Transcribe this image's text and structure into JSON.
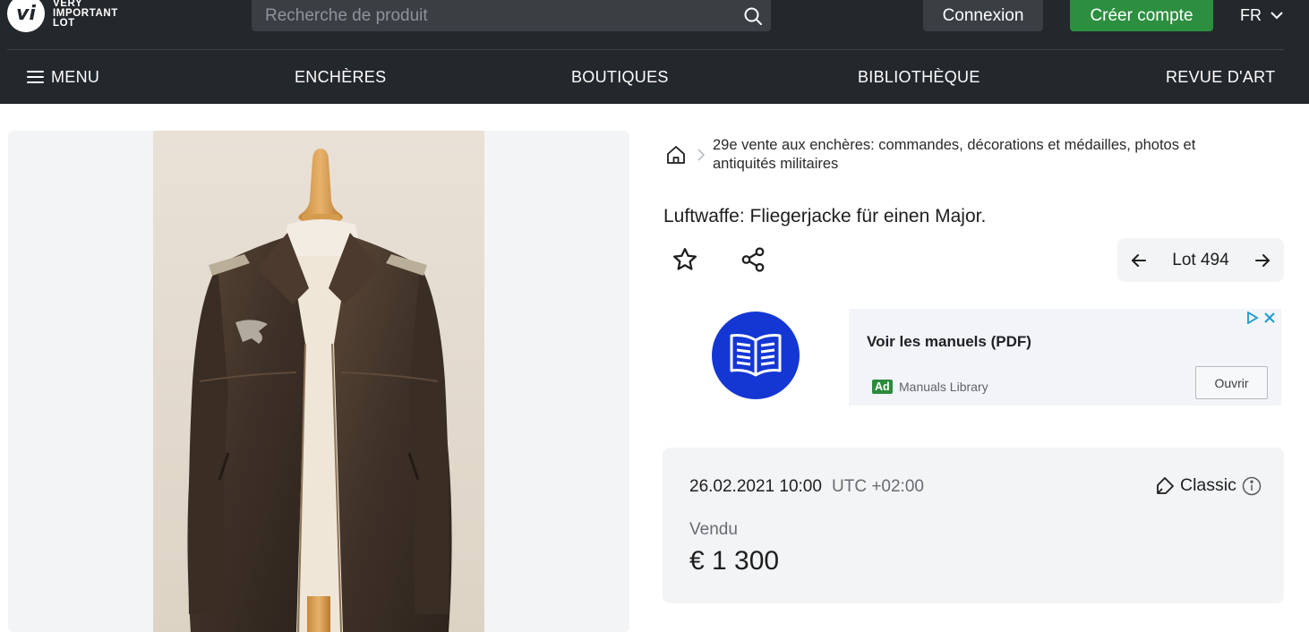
{
  "header": {
    "logo": {
      "mark": "vi",
      "lines": [
        "VERY",
        "IMPORTANT",
        "LOT"
      ]
    },
    "search": {
      "placeholder": "Recherche de produit",
      "icon": "search-icon"
    },
    "login_label": "Connexion",
    "signup_label": "Créer compte",
    "language": "FR",
    "colors": {
      "bar": "#23282c",
      "signup": "#2c8f3f"
    }
  },
  "nav": {
    "menu_label": "MENU",
    "items": [
      "ENCHÈRES",
      "BOUTIQUES",
      "BIBLIOTHÈQUE",
      "REVUE D'ART"
    ]
  },
  "breadcrumb": {
    "home_icon": "home-icon",
    "text": "29e vente aux enchères: commandes, décorations et médailles, photos et antiquités militaires"
  },
  "lot": {
    "title": "Luftwaffe: Fliegerjacke für einen Major.",
    "label": "Lot 494",
    "image": "leather-jacket-photo"
  },
  "ad": {
    "title": "Voir les manuels (PDF)",
    "badge": "Ad",
    "source": "Manuals Library",
    "button": "Ouvrir",
    "brand_color": "#1437d4"
  },
  "sale": {
    "date": "26.02.2021 10:00",
    "timezone": "UTC +02:00",
    "type": "Classic",
    "status": "Vendu",
    "price": "€ 1 300"
  }
}
